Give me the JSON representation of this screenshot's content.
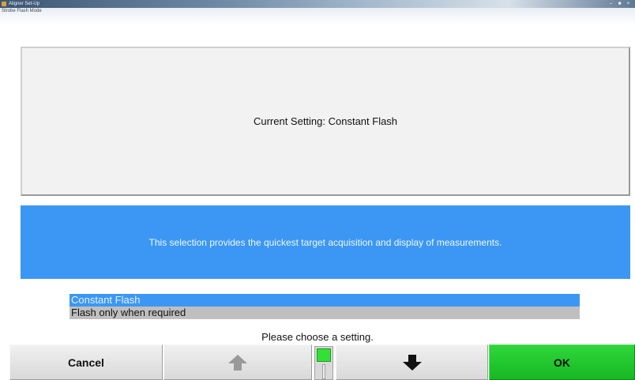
{
  "window": {
    "title": "Aligner Set-Up",
    "subtitle": "Strobe Flash Mode",
    "controls": {
      "minimize": "–",
      "maximize": "■",
      "close": "×"
    }
  },
  "current_setting": {
    "text": "Current Setting:  Constant Flash"
  },
  "description": {
    "text": "This selection provides the quickest target acquisition and display of measurements."
  },
  "options": [
    {
      "label": "Constant Flash",
      "selected": true
    },
    {
      "label": "Flash only when required",
      "selected": false
    }
  ],
  "prompt": "Please choose a setting.",
  "buttons": {
    "cancel": "Cancel",
    "up_icon": "up-arrow-icon",
    "down_icon": "down-arrow-icon",
    "ok": "OK"
  },
  "colors": {
    "selection": "#3b97f3",
    "ok_button": "#22c92d",
    "panel": "#f2f2f2"
  }
}
